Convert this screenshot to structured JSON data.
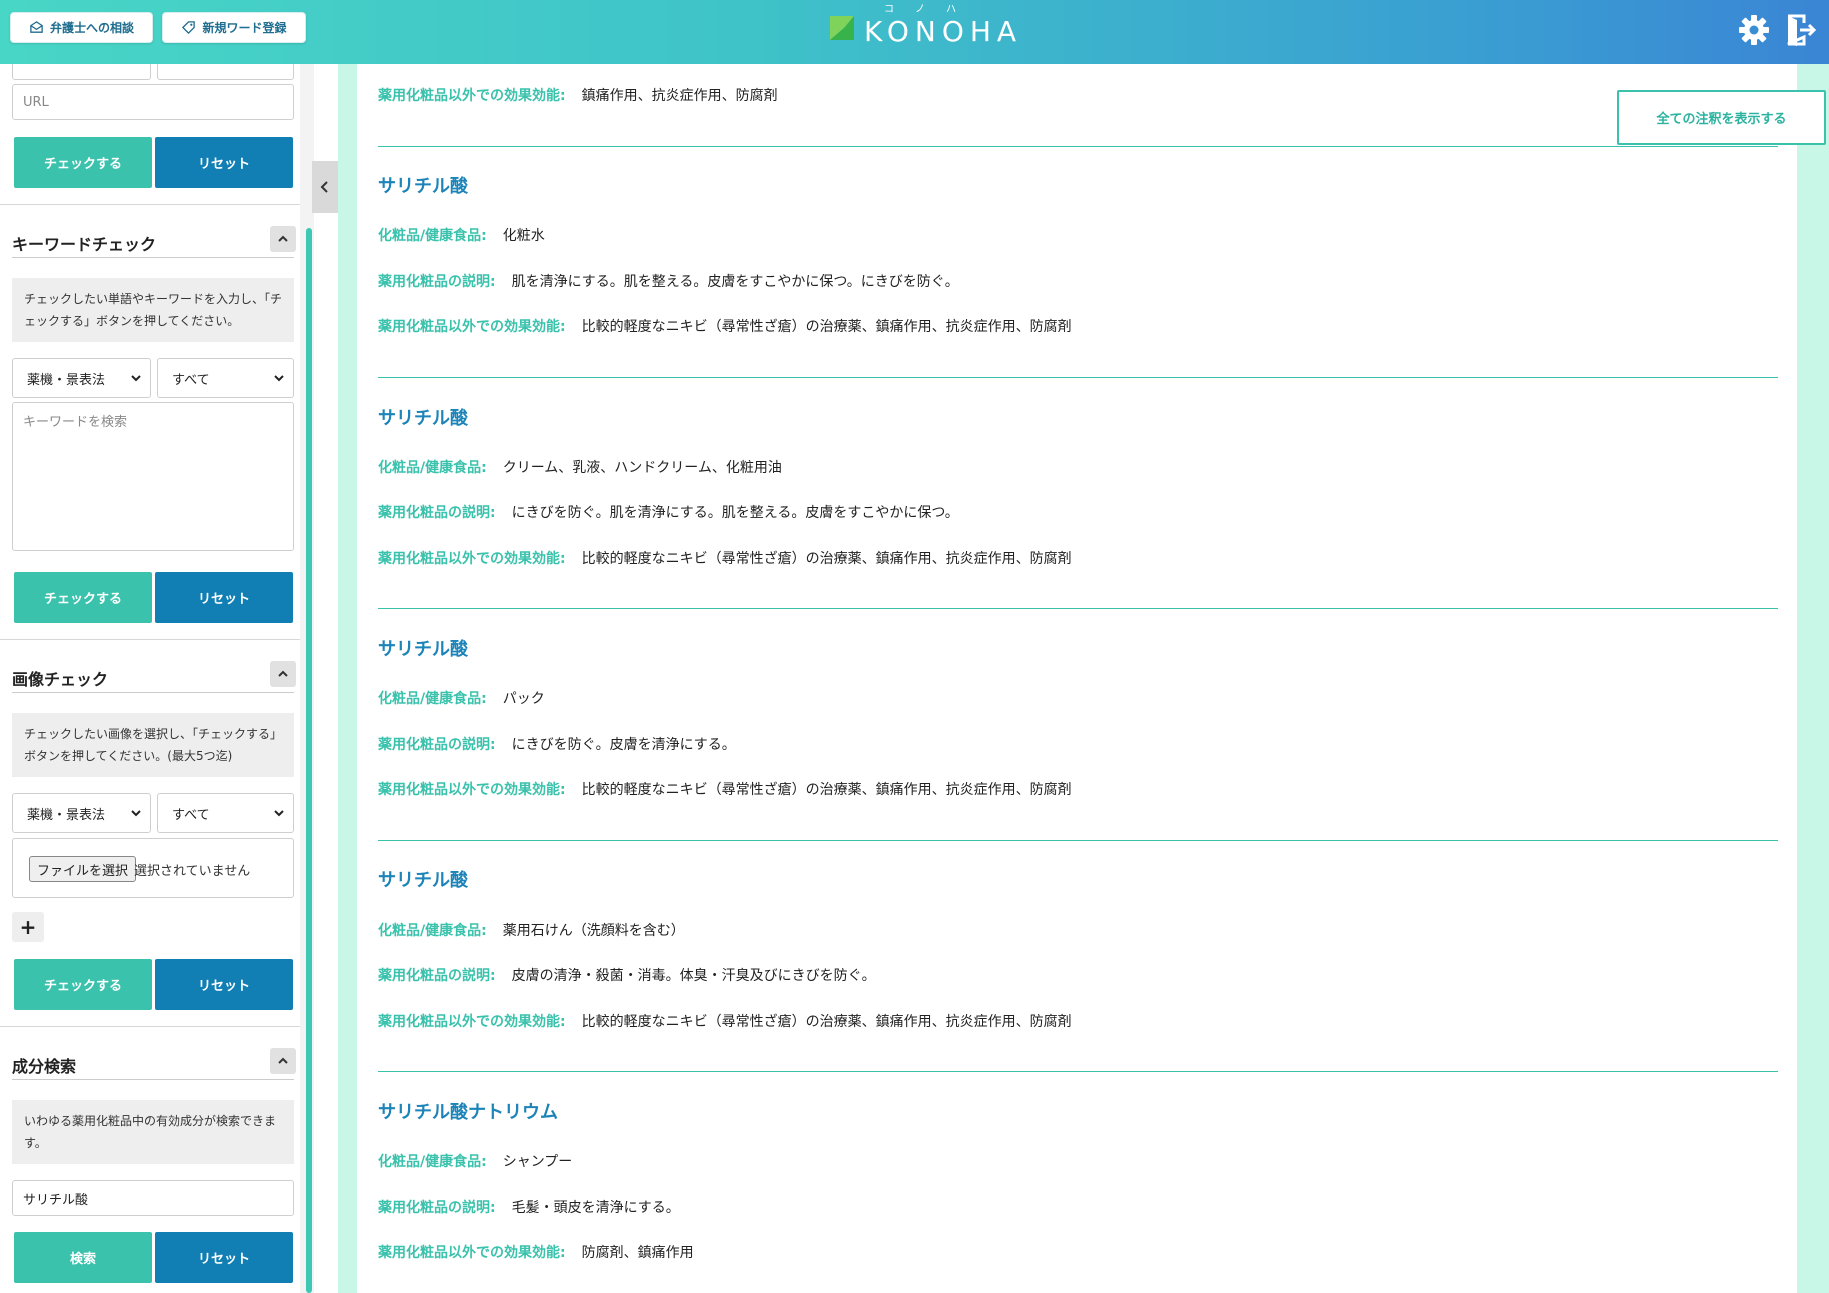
{
  "header": {
    "consult_label": "弁護士への相談",
    "new_word_label": "新規ワード登録",
    "logo_text": "KONOHA",
    "logo_ruby": "コノハ"
  },
  "sidebar": {
    "url": {
      "placeholder": "URL"
    },
    "url_check_label": "チェックする",
    "url_reset_label": "リセット",
    "keyword": {
      "title": "キーワードチェック",
      "note": "チェックしたい単語やキーワードを入力し、「チェックする」ボタンを押してください。",
      "select_law": "薬機・景表法",
      "select_scope": "すべて",
      "placeholder": "キーワードを検索",
      "check_label": "チェックする",
      "reset_label": "リセット"
    },
    "image": {
      "title": "画像チェック",
      "note": "チェックしたい画像を選択し、「チェックする」ボタンを押してください。(最大5つ迄)",
      "select_law": "薬機・景表法",
      "select_scope": "すべて",
      "file_button": "ファイルを選択",
      "file_status": "選択されていません",
      "add_label": "+",
      "check_label": "チェックする",
      "reset_label": "リセット"
    },
    "ingredient": {
      "title": "成分検索",
      "note": "いわゆる薬用化粧品中の有効成分が検索できます。",
      "value": "サリチル酸",
      "search_label": "検索",
      "reset_label": "リセット"
    }
  },
  "main": {
    "show_all_label": "全ての注釈を表示する",
    "labels": {
      "product": "化粧品/健康食品:",
      "description": "薬用化粧品の説明:",
      "other_effect": "薬用化粧品以外での効果効能:"
    },
    "top_partial": {
      "other_effect": "鎮痛作用、抗炎症作用、防腐剤"
    },
    "entries": [
      {
        "name": "サリチル酸",
        "product": "化粧水",
        "description": "肌を清浄にする。肌を整える。皮膚をすこやかに保つ。にきびを防ぐ。",
        "other_effect": "比較的軽度なニキビ（尋常性ざ瘡）の治療薬、鎮痛作用、抗炎症作用、防腐剤"
      },
      {
        "name": "サリチル酸",
        "product": "クリーム、乳液、ハンドクリーム、化粧用油",
        "description": "にきびを防ぐ。肌を清浄にする。肌を整える。皮膚をすこやかに保つ。",
        "other_effect": "比較的軽度なニキビ（尋常性ざ瘡）の治療薬、鎮痛作用、抗炎症作用、防腐剤"
      },
      {
        "name": "サリチル酸",
        "product": "パック",
        "description": "にきびを防ぐ。皮膚を清浄にする。",
        "other_effect": "比較的軽度なニキビ（尋常性ざ瘡）の治療薬、鎮痛作用、抗炎症作用、防腐剤"
      },
      {
        "name": "サリチル酸",
        "product": "薬用石けん（洗顔料を含む）",
        "description": "皮膚の清浄・殺菌・消毒。体臭・汗臭及びにきびを防ぐ。",
        "other_effect": "比較的軽度なニキビ（尋常性ざ瘡）の治療薬、鎮痛作用、抗炎症作用、防腐剤"
      },
      {
        "name": "サリチル酸ナトリウム",
        "product": "シャンプー",
        "description": "毛髪・頭皮を清浄にする。",
        "other_effect": "防腐剤、鎮痛作用"
      }
    ]
  },
  "colors": {
    "accent_teal": "#3ac2ac",
    "accent_blue": "#117fb4",
    "title_blue": "#1c84b8"
  },
  "icons": [
    "mail-icon",
    "tag-icon",
    "leaf-logo-icon",
    "gear-icon",
    "logout-icon",
    "chevron-up-icon",
    "chevron-down-icon",
    "chevron-left-icon"
  ]
}
